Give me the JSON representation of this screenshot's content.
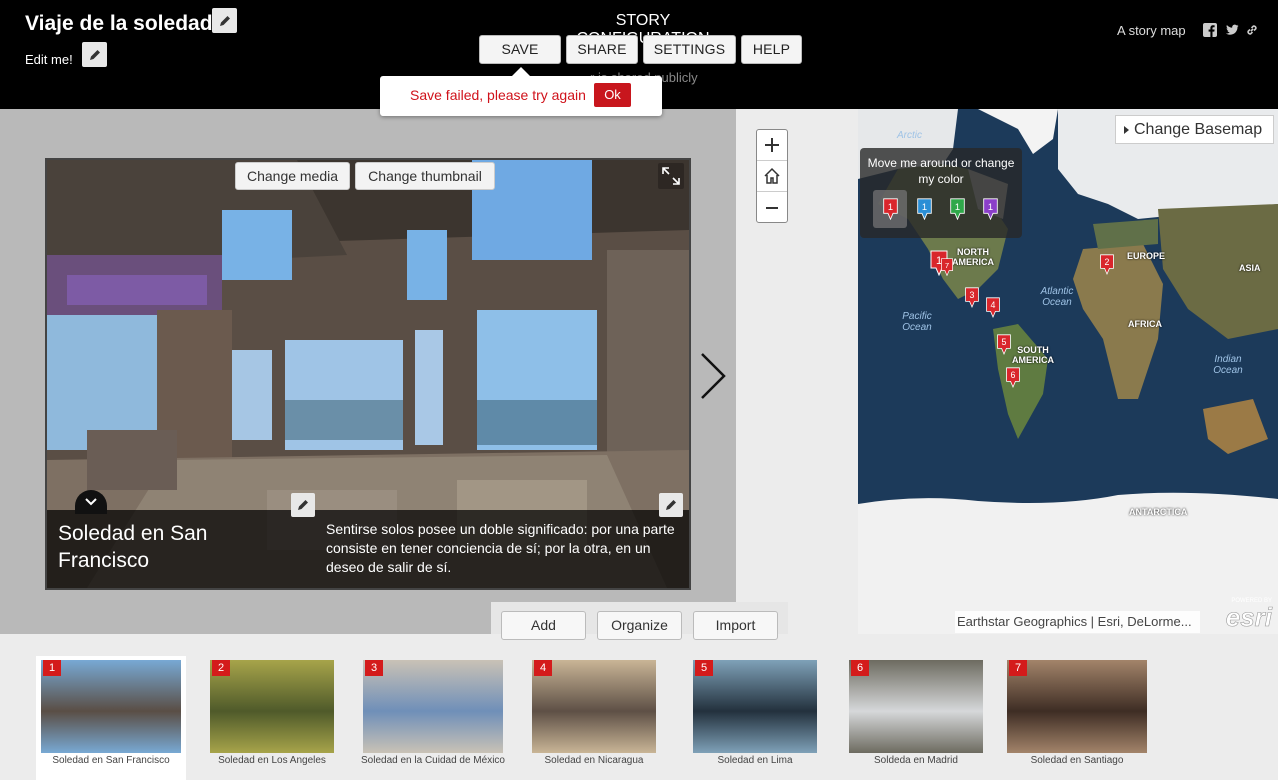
{
  "header": {
    "title": "Viaje de la soledad",
    "subtitle": "Edit me!",
    "config_title": "STORY CONFIGURATION",
    "buttons": [
      "SAVE",
      "SHARE",
      "SETTINGS",
      "HELP"
    ],
    "notice": "r is shared publicly",
    "brand": "A story map"
  },
  "popup": {
    "message": "Save failed, please try again",
    "ok": "Ok"
  },
  "media": {
    "change_media": "Change media",
    "change_thumbnail": "Change thumbnail",
    "caption_title": "Soledad en San Francisco",
    "caption_text": "Sentirse solos posee un doble significado: por una parte consiste en tener conciencia de sí; por la otra, en un deseo de salir de sí."
  },
  "map": {
    "basemap_label": "Change Basemap",
    "picker_text": "Move me around or change my color",
    "picker_pins": [
      {
        "label": "1",
        "color": "#d9262c",
        "selected": true
      },
      {
        "label": "1",
        "color": "#2b8fd6",
        "selected": false
      },
      {
        "label": "1",
        "color": "#2fa84a",
        "selected": false
      },
      {
        "label": "1",
        "color": "#8b3fc9",
        "selected": false
      }
    ],
    "markers": [
      "1",
      "2",
      "3",
      "4",
      "5",
      "6",
      "7"
    ],
    "marker_color": "#d9262c",
    "labels": {
      "arctic": "Arctic",
      "pacific": "Pacific Ocean",
      "atlantic": "Atlantic Ocean",
      "indian": "Indian Ocean",
      "north_america": "NORTH AMERICA",
      "south_america": "SOUTH AMERICA",
      "europe": "EUROPE",
      "asia": "ASIA",
      "africa": "AFRICA",
      "antarctica": "ANTARCTICA"
    },
    "attribution": "Earthstar Geographics | Esri, DeLorme..."
  },
  "tools": [
    "Add",
    "Organize",
    "Import"
  ],
  "thumbnails": [
    {
      "num": "1",
      "label": "Soledad en San Francisco",
      "colors": [
        "#5a4e45",
        "#78a9d4"
      ],
      "active": true
    },
    {
      "num": "2",
      "label": "Soledad en Los Angeles",
      "colors": [
        "#4f5a2a",
        "#a7a44a"
      ],
      "active": false
    },
    {
      "num": "3",
      "label": "Soledad en la Cuidad de México",
      "colors": [
        "#6f8fb8",
        "#c9c2b6"
      ],
      "active": false
    },
    {
      "num": "4",
      "label": "Soledad en Nicaragua",
      "colors": [
        "#5e5046",
        "#c9b596"
      ],
      "active": false
    },
    {
      "num": "5",
      "label": "Soledad en Lima",
      "colors": [
        "#23313d",
        "#7fa1b8"
      ],
      "active": false
    },
    {
      "num": "6",
      "label": "Soldeda en Madrid",
      "colors": [
        "#d6d8da",
        "#6d6b60"
      ],
      "active": false
    },
    {
      "num": "7",
      "label": "Soledad en Santiago",
      "colors": [
        "#3e2d24",
        "#a3846a"
      ],
      "active": false
    }
  ]
}
